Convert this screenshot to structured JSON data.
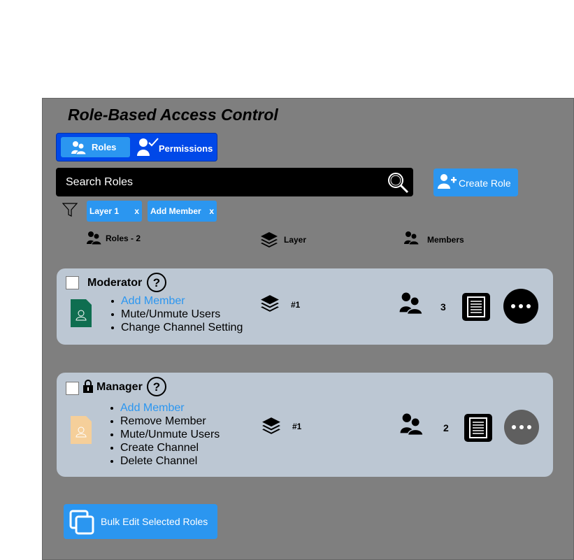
{
  "page": {
    "title": "Role-Based Access Control"
  },
  "tabs": {
    "roles": "Roles",
    "permissions": "Permissions"
  },
  "search": {
    "placeholder": "Search Roles"
  },
  "create_role": {
    "label": "Create Role"
  },
  "filters": [
    {
      "label": "Layer 1",
      "close": "x"
    },
    {
      "label": "Add Member",
      "close": "x"
    }
  ],
  "columns": {
    "roles": "Roles - 2",
    "layer": "Layer",
    "members": "Members"
  },
  "roles": [
    {
      "name": "Moderator",
      "locked": false,
      "permissions": [
        "Add Member",
        "Mute/Unmute Users",
        "Change Channel Setting"
      ],
      "layer": "#1",
      "members": "3",
      "doc_color": "#0f6e50",
      "more_color": "#000000"
    },
    {
      "name": "Manager",
      "locked": true,
      "permissions": [
        "Add Member",
        "Remove Member",
        "Mute/Unmute Users",
        "Create Channel",
        "Delete Channel"
      ],
      "layer": "#1",
      "members": "2",
      "doc_color": "#f5cf9a",
      "more_color": "#5f5f5f"
    }
  ],
  "bulk_edit": {
    "label": "Bulk Edit Selected Roles"
  },
  "colors": {
    "accent": "#2b96f0",
    "tab_bg": "#0048e8",
    "panel": "#7f7f7f",
    "card": "#bcc7d3",
    "link": "#2b96f0"
  }
}
